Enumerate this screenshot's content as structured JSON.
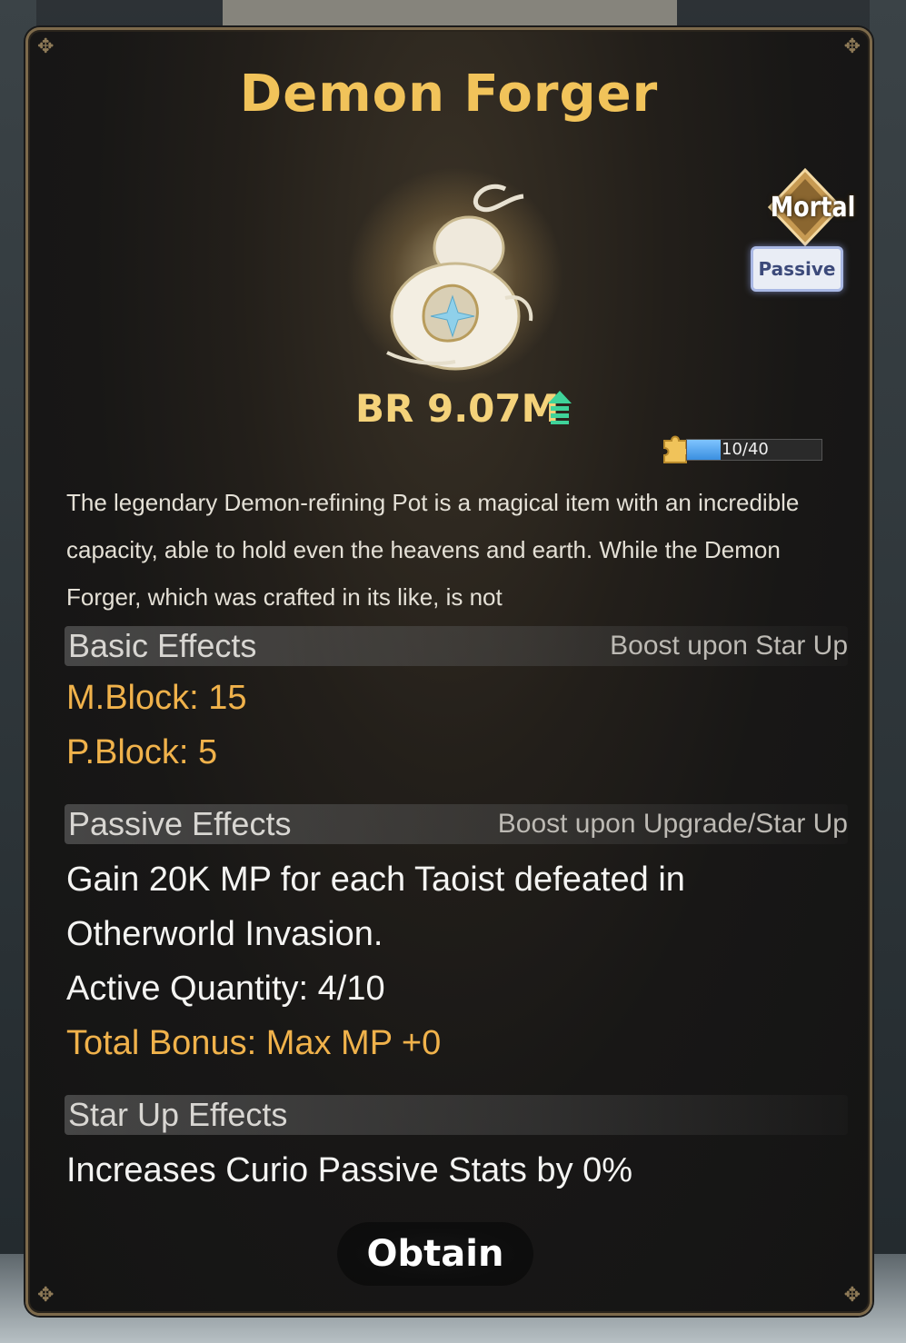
{
  "item": {
    "name": "Demon Forger",
    "rarity": "Mortal",
    "type": "Passive"
  },
  "battle_rating": {
    "label": "BR 9.07M"
  },
  "fragments": {
    "progress_text": "10/40",
    "progress_fraction": 0.25
  },
  "description": "The legendary Demon-refining Pot is a magical item with an incredible capacity, able to hold even the heavens and earth. While the Demon Forger, which was crafted in its like, is not",
  "basic_effects": {
    "title": "Basic Effects",
    "note": "Boost upon Star Up",
    "stats": [
      "M.Block: 15",
      "P.Block: 5"
    ]
  },
  "passive_effects": {
    "title": "Passive Effects",
    "note": "Boost upon Upgrade/Star Up",
    "line1": "Gain 20K MP for each Taoist defeated in",
    "line2": "Otherworld Invasion.",
    "active_quantity": "Active Quantity: 4/10",
    "total_bonus": "Total Bonus: Max MP +0"
  },
  "star_up_effects": {
    "title": "Star Up Effects",
    "text": "Increases Curio Passive Stats by 0%"
  },
  "actions": {
    "obtain_label": "Obtain"
  },
  "colors": {
    "title_gold": "#f1c35a",
    "stat_orange": "#f0b24b",
    "br_arrow_green": "#3fd39a",
    "fragment_fill": "#3a8fe0"
  },
  "icons": {
    "rarity_badge": "diamond-badge-icon",
    "br_trend": "arrow-up-icon",
    "fragment": "puzzle-piece-icon",
    "item": "gourd-icon"
  }
}
